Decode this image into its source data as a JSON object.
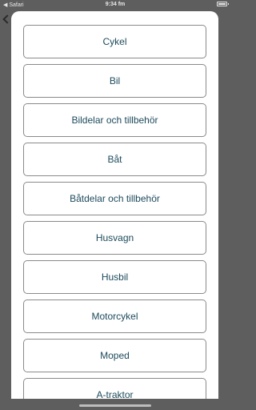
{
  "status_bar": {
    "back_app": "◀ Safari",
    "time": "9:34 fm",
    "battery_level": 0.8
  },
  "options": [
    {
      "label": "Cykel"
    },
    {
      "label": "Bil"
    },
    {
      "label": "Bildelar och tillbehör"
    },
    {
      "label": "Båt"
    },
    {
      "label": "Båtdelar och tillbehör"
    },
    {
      "label": "Husvagn"
    },
    {
      "label": "Husbil"
    },
    {
      "label": "Motorcykel"
    },
    {
      "label": "Moped"
    },
    {
      "label": "A-traktor"
    }
  ],
  "colors": {
    "text": "#1d4a5c",
    "border": "#8a8a8a",
    "overlay": "#5e5e5e",
    "sheet": "#ffffff"
  }
}
